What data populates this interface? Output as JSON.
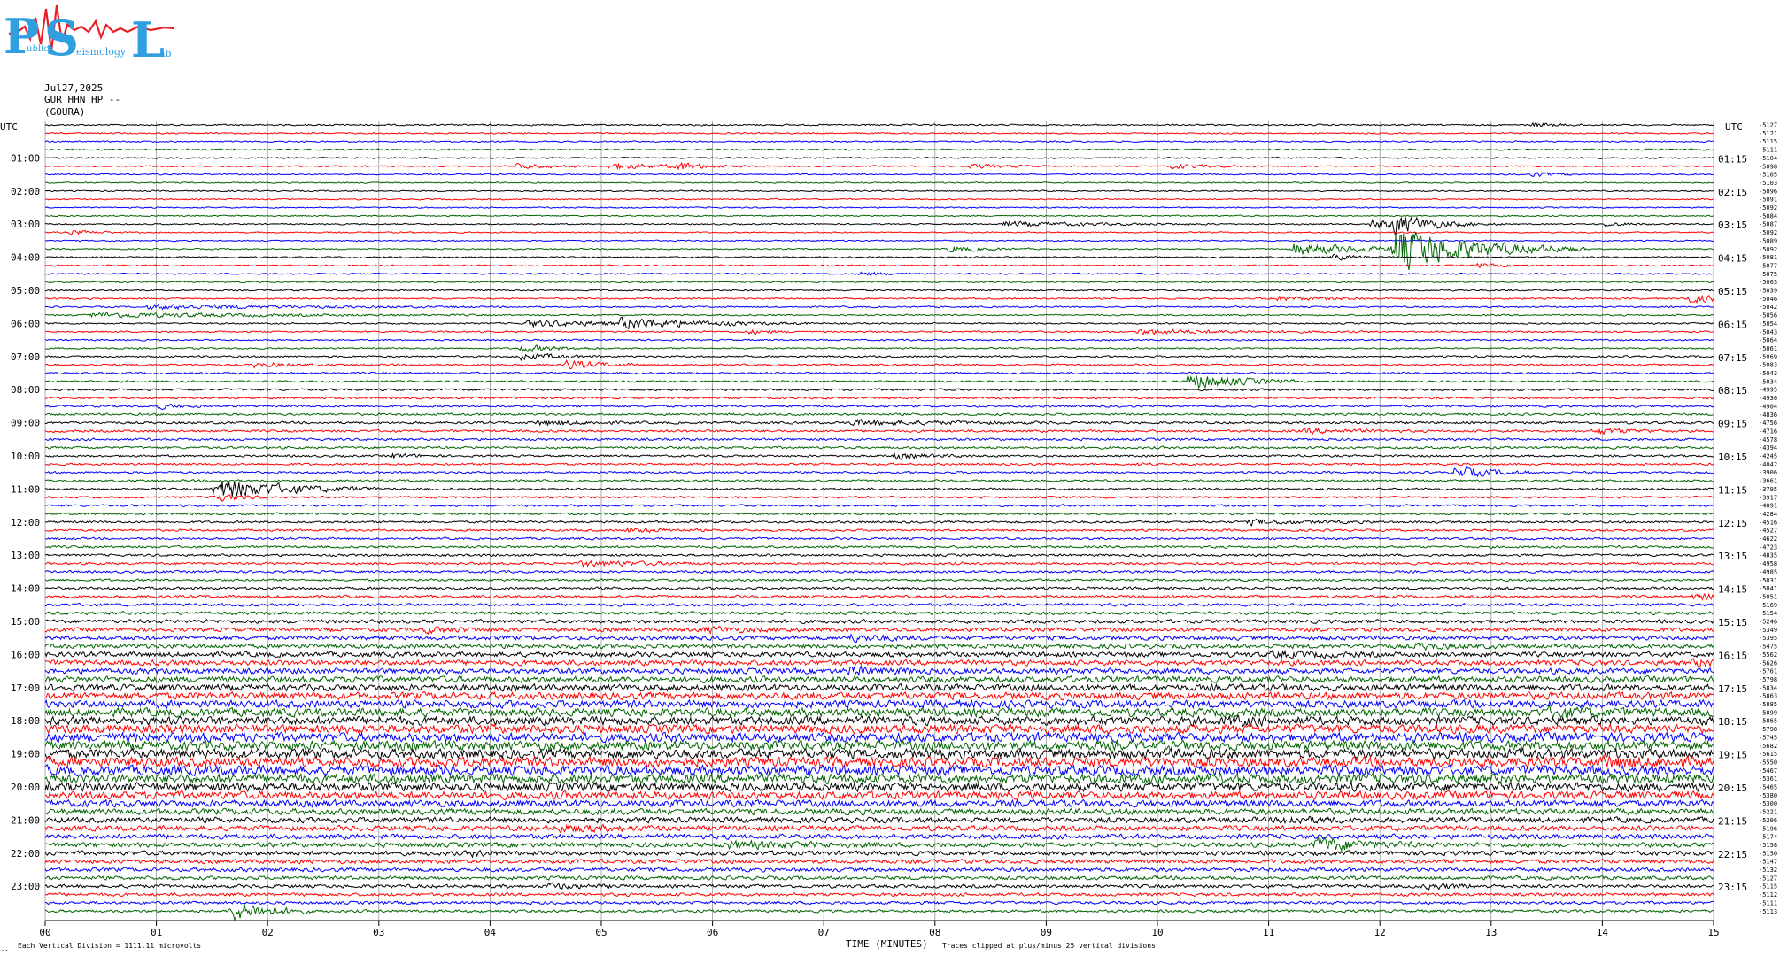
{
  "logo": {
    "letters": [
      "P",
      "S",
      "L"
    ],
    "words": [
      "ublic",
      "eismology",
      "ab"
    ],
    "colors": {
      "letters": "#2f9fe0",
      "wave": "#e8202a"
    }
  },
  "header": {
    "date": "Jul27,2025",
    "station": "GUR HHN HP --",
    "site": "(GOURA)"
  },
  "chart_data": {
    "type": "line",
    "title": "",
    "utc_left_label": "UTC",
    "utc_right_label": "UTC",
    "xlabel": "TIME (MINUTES)",
    "x_ticks": [
      "00",
      "01",
      "02",
      "03",
      "04",
      "05",
      "06",
      "07",
      "08",
      "09",
      "10",
      "11",
      "12",
      "13",
      "14",
      "15"
    ],
    "xlim": [
      0,
      15
    ],
    "rows_per_hour": 4,
    "row_count": 96,
    "row_colors": [
      "#000000",
      "#ff0000",
      "#0000ff",
      "#006400"
    ],
    "left_hour_labels": [
      "01:00",
      "02:00",
      "03:00",
      "04:00",
      "05:00",
      "06:00",
      "07:00",
      "08:00",
      "09:00",
      "10:00",
      "11:00",
      "12:00",
      "13:00",
      "14:00",
      "15:00",
      "16:00",
      "17:00",
      "18:00",
      "19:00",
      "20:00",
      "21:00",
      "22:00",
      "23:00"
    ],
    "right_hour_labels": [
      "01:15",
      "02:15",
      "03:15",
      "04:15",
      "05:15",
      "06:15",
      "07:15",
      "08:15",
      "09:15",
      "10:15",
      "11:15",
      "12:15",
      "13:15",
      "14:15",
      "15:15",
      "16:15",
      "17:15",
      "18:15",
      "19:15",
      "20:15",
      "21:15",
      "22:15",
      "23:15"
    ],
    "offsets": [
      "-5127",
      "-5121",
      "-5115",
      "-5111",
      "-5104",
      "-5098",
      "-5105",
      "-5103",
      "-5096",
      "-5091",
      "-5092",
      "-5084",
      "-5087",
      "-5092",
      "-5089",
      "-5092",
      "-5081",
      "-5077",
      "-5075",
      "-5063",
      "-5039",
      "-5046",
      "-5042",
      "-5056",
      "-5054",
      "-5043",
      "-5064",
      "-5061",
      "-5069",
      "-5083",
      "-5043",
      "-5034",
      "-4995",
      "-4936",
      "-4904",
      "-4836",
      "-4756",
      "-4716",
      "-4578",
      "-4394",
      "-4245",
      "-4042",
      "-3906",
      "-3661",
      "-3795",
      "-3917",
      "-4091",
      "-4284",
      "-4516",
      "-4527",
      "-4622",
      "-4723",
      "-4835",
      "-4958",
      "-4985",
      "-5031",
      "-5041",
      "-5051",
      "-5169",
      "-5154",
      "-5246",
      "-5349",
      "-5395",
      "-5475",
      "-5562",
      "-5626",
      "-5761",
      "-5798",
      "-5834",
      "-5863",
      "-5885",
      "-5899",
      "-5865",
      "-5798",
      "-5745",
      "-5682",
      "-5615",
      "-5550",
      "-5467",
      "-5361",
      "-5465",
      "-5380",
      "-5300",
      "-5221",
      "-5206",
      "-5196",
      "-5174",
      "-5158",
      "-5150",
      "-5147",
      "-5132",
      "-5127",
      "-5115",
      "-5112",
      "-5111",
      "-5113"
    ],
    "noise_level": [
      0.6,
      0.55,
      0.55,
      0.55,
      0.5,
      0.5,
      0.5,
      0.5,
      0.5,
      0.5,
      0.5,
      0.5,
      0.5,
      0.5,
      0.5,
      0.5,
      0.55,
      0.55,
      0.55,
      0.55,
      0.6,
      0.6,
      0.6,
      0.6,
      0.6,
      0.6,
      0.6,
      0.6,
      0.7,
      0.7,
      0.7,
      0.7,
      0.8,
      0.8,
      0.8,
      0.85,
      0.9,
      0.9,
      0.9,
      0.9,
      0.8,
      0.8,
      0.8,
      0.8,
      0.8,
      0.8,
      0.8,
      0.8,
      0.85,
      0.85,
      0.85,
      0.9,
      0.9,
      0.9,
      0.9,
      0.9,
      1.0,
      1.0,
      1.1,
      1.2,
      1.4,
      1.5,
      1.6,
      1.7,
      1.9,
      2.0,
      2.1,
      2.3,
      2.5,
      2.7,
      2.9,
      3.1,
      3.2,
      3.3,
      3.4,
      3.5,
      3.6,
      3.7,
      3.7,
      3.5,
      3.2,
      2.9,
      2.6,
      2.3,
      2.1,
      2.0,
      1.9,
      1.8,
      1.7,
      1.6,
      1.5,
      1.4,
      1.3,
      1.2,
      1.1,
      1.0
    ],
    "events": [
      {
        "row": 0,
        "minute": 13.35,
        "amp": 3,
        "dur": 0.2
      },
      {
        "row": 5,
        "minute": 4.2,
        "amp": 4,
        "dur": 0.3
      },
      {
        "row": 5,
        "minute": 5.05,
        "amp": 4,
        "dur": 0.5
      },
      {
        "row": 5,
        "minute": 5.65,
        "amp": 6,
        "dur": 0.2
      },
      {
        "row": 5,
        "minute": 8.3,
        "amp": 3,
        "dur": 0.3
      },
      {
        "row": 5,
        "minute": 10.1,
        "amp": 3,
        "dur": 0.3
      },
      {
        "row": 6,
        "minute": 13.35,
        "amp": 3,
        "dur": 0.2
      },
      {
        "row": 12,
        "minute": 8.6,
        "amp": 3,
        "dur": 0.8
      },
      {
        "row": 12,
        "minute": 11.9,
        "amp": 6,
        "dur": 0.5
      },
      {
        "row": 12,
        "minute": 12.1,
        "amp": 10,
        "dur": 0.3
      },
      {
        "row": 12,
        "minute": 14.0,
        "amp": 3,
        "dur": 0.2
      },
      {
        "row": 13,
        "minute": 0.2,
        "amp": 3,
        "dur": 0.2
      },
      {
        "row": 15,
        "minute": 8.1,
        "amp": 4,
        "dur": 0.3
      },
      {
        "row": 15,
        "minute": 11.2,
        "amp": 8,
        "dur": 0.6
      },
      {
        "row": 15,
        "minute": 12.1,
        "amp": 28,
        "dur": 0.7
      },
      {
        "row": 16,
        "minute": 11.55,
        "amp": 4,
        "dur": 0.2
      },
      {
        "row": 17,
        "minute": 12.85,
        "amp": 3,
        "dur": 0.2
      },
      {
        "row": 18,
        "minute": 7.3,
        "amp": 3,
        "dur": 0.2
      },
      {
        "row": 21,
        "minute": 11.0,
        "amp": 3,
        "dur": 0.5
      },
      {
        "row": 21,
        "minute": 14.7,
        "amp": 5,
        "dur": 0.6
      },
      {
        "row": 22,
        "minute": 0.9,
        "amp": 3,
        "dur": 1.2
      },
      {
        "row": 23,
        "minute": 0.4,
        "amp": 3,
        "dur": 1.4
      },
      {
        "row": 24,
        "minute": 4.3,
        "amp": 4,
        "dur": 0.8
      },
      {
        "row": 24,
        "minute": 5.15,
        "amp": 6,
        "dur": 0.7
      },
      {
        "row": 25,
        "minute": 6.3,
        "amp": 3,
        "dur": 0.2
      },
      {
        "row": 25,
        "minute": 9.8,
        "amp": 3,
        "dur": 0.8
      },
      {
        "row": 27,
        "minute": 4.25,
        "amp": 5,
        "dur": 0.3
      },
      {
        "row": 28,
        "minute": 4.25,
        "amp": 5,
        "dur": 0.3
      },
      {
        "row": 29,
        "minute": 1.85,
        "amp": 3,
        "dur": 0.3
      },
      {
        "row": 29,
        "minute": 4.65,
        "amp": 6,
        "dur": 0.3
      },
      {
        "row": 31,
        "minute": 10.25,
        "amp": 12,
        "dur": 0.4
      },
      {
        "row": 34,
        "minute": 1.0,
        "amp": 3,
        "dur": 0.2
      },
      {
        "row": 36,
        "minute": 4.4,
        "amp": 3,
        "dur": 0.4
      },
      {
        "row": 36,
        "minute": 7.2,
        "amp": 3,
        "dur": 0.8
      },
      {
        "row": 37,
        "minute": 11.3,
        "amp": 3,
        "dur": 0.4
      },
      {
        "row": 37,
        "minute": 13.9,
        "amp": 4,
        "dur": 0.3
      },
      {
        "row": 40,
        "minute": 3.1,
        "amp": 3,
        "dur": 0.2
      },
      {
        "row": 40,
        "minute": 7.6,
        "amp": 4,
        "dur": 0.3
      },
      {
        "row": 41,
        "minute": 9.8,
        "amp": 3,
        "dur": 0.1
      },
      {
        "row": 42,
        "minute": 12.65,
        "amp": 8,
        "dur": 0.3
      },
      {
        "row": 44,
        "minute": 1.5,
        "amp": 14,
        "dur": 0.6
      },
      {
        "row": 45,
        "minute": 1.5,
        "amp": 6,
        "dur": 0.2
      },
      {
        "row": 48,
        "minute": 10.8,
        "amp": 3,
        "dur": 0.5
      },
      {
        "row": 49,
        "minute": 5.2,
        "amp": 3,
        "dur": 0.3
      },
      {
        "row": 53,
        "minute": 4.8,
        "amp": 4,
        "dur": 0.5
      },
      {
        "row": 57,
        "minute": 14.8,
        "amp": 4,
        "dur": 0.3
      },
      {
        "row": 61,
        "minute": 3.4,
        "amp": 3,
        "dur": 0.3
      },
      {
        "row": 61,
        "minute": 5.9,
        "amp": 3,
        "dur": 0.4
      },
      {
        "row": 62,
        "minute": 7.2,
        "amp": 4,
        "dur": 0.3
      },
      {
        "row": 63,
        "minute": 12.3,
        "amp": 3,
        "dur": 0.3
      },
      {
        "row": 64,
        "minute": 11.0,
        "amp": 3,
        "dur": 0.4
      },
      {
        "row": 65,
        "minute": 14.8,
        "amp": 4,
        "dur": 0.3
      },
      {
        "row": 66,
        "minute": 7.2,
        "amp": 5,
        "dur": 0.3
      },
      {
        "row": 71,
        "minute": 13.5,
        "amp": 4,
        "dur": 0.4
      },
      {
        "row": 72,
        "minute": 10.6,
        "amp": 4,
        "dur": 0.3
      },
      {
        "row": 77,
        "minute": 14.0,
        "amp": 5,
        "dur": 0.4
      },
      {
        "row": 84,
        "minute": 11.1,
        "amp": 4,
        "dur": 0.3
      },
      {
        "row": 85,
        "minute": 4.6,
        "amp": 4,
        "dur": 0.4
      },
      {
        "row": 87,
        "minute": 6.1,
        "amp": 4,
        "dur": 0.6
      },
      {
        "row": 87,
        "minute": 11.4,
        "amp": 9,
        "dur": 0.4
      },
      {
        "row": 88,
        "minute": 3.8,
        "amp": 3,
        "dur": 0.2
      },
      {
        "row": 92,
        "minute": 4.5,
        "amp": 3,
        "dur": 0.3
      },
      {
        "row": 92,
        "minute": 12.4,
        "amp": 3,
        "dur": 0.3
      },
      {
        "row": 95,
        "minute": 1.65,
        "amp": 14,
        "dur": 0.3
      }
    ]
  },
  "footer": {
    "scale_text": "Each Vertical Division = 1111.11 microvolts",
    "clip_text": "Traces clipped at plus/minus 25 vertical divisions",
    "corner_mark": ".."
  }
}
